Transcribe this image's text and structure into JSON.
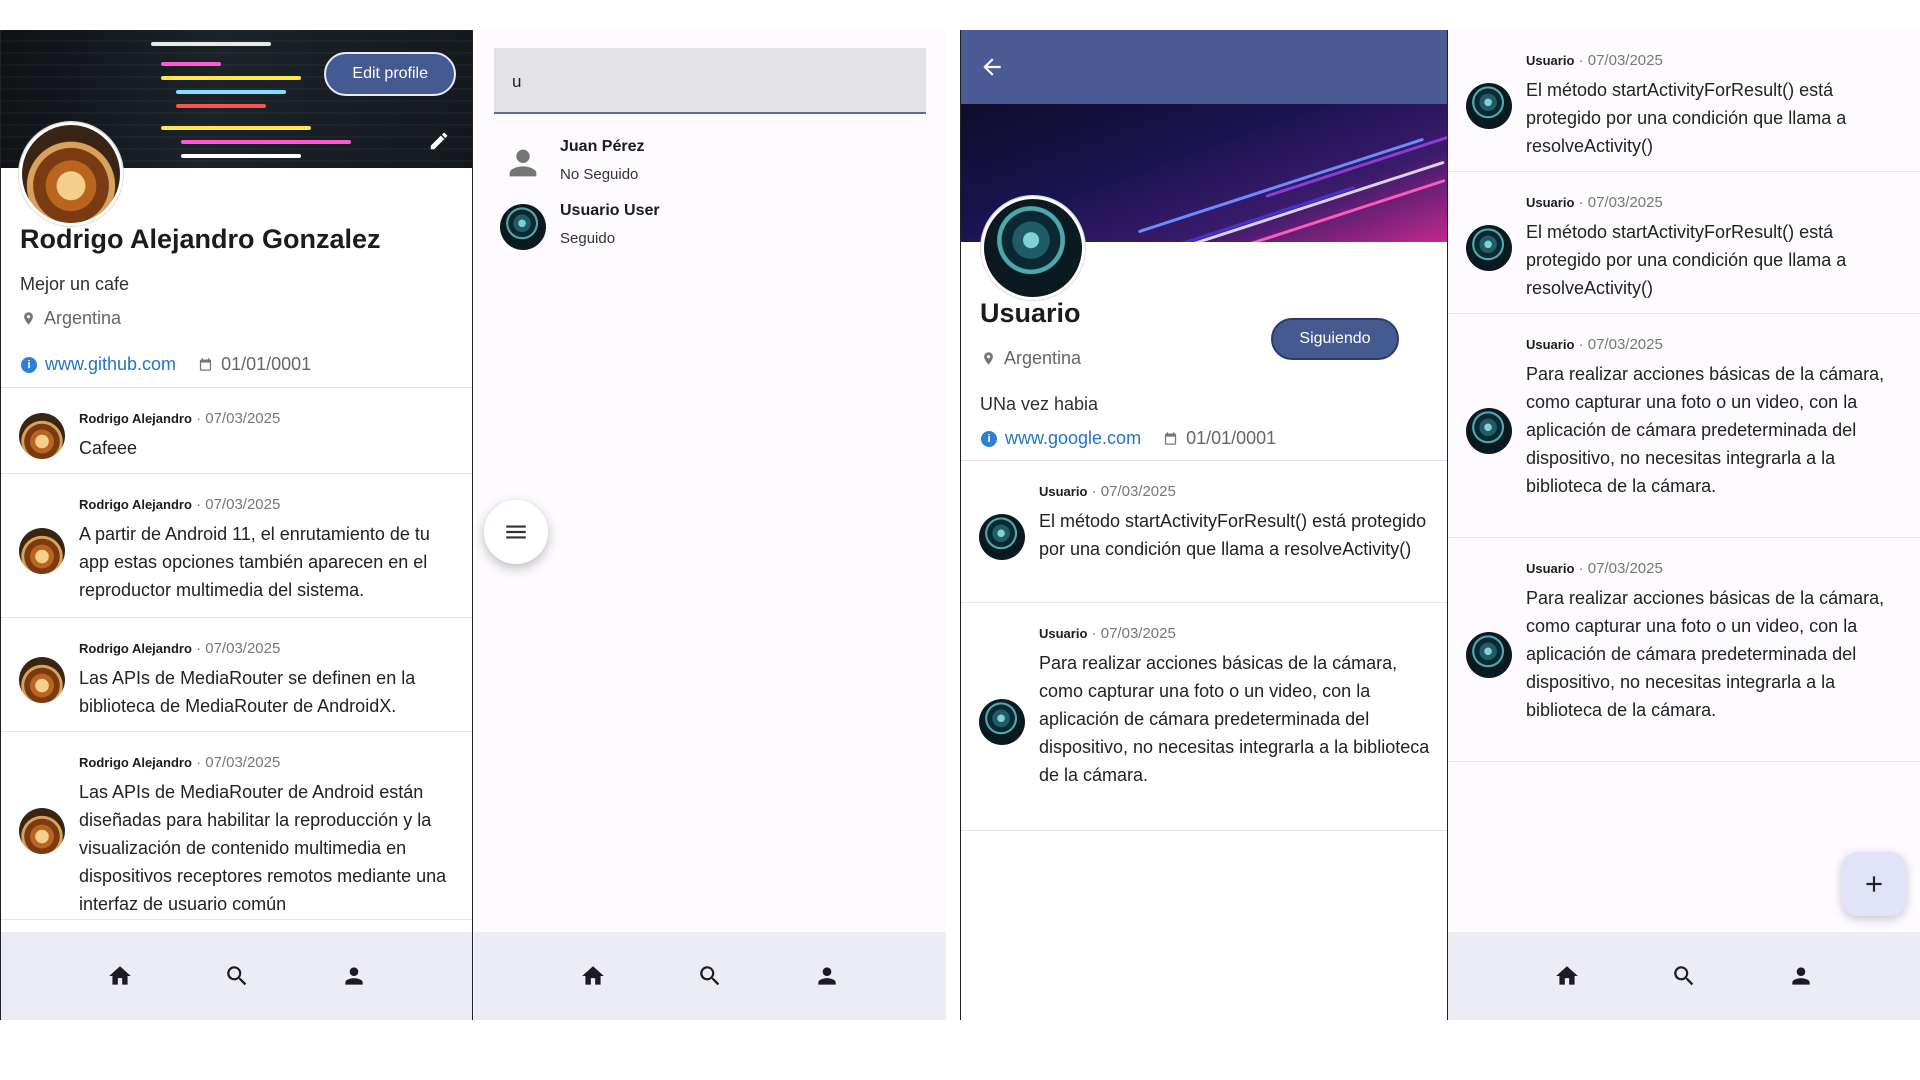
{
  "screen1": {
    "edit_profile_label": "Edit profile",
    "name": "Rodrigo Alejandro Gonzalez",
    "bio": "Mejor un cafe",
    "location": "Argentina",
    "website": "www.github.com",
    "date": "01/01/0001",
    "posts": [
      {
        "author": "Rodrigo Alejandro",
        "date": "07/03/2025",
        "text": "Cafeee"
      },
      {
        "author": "Rodrigo Alejandro",
        "date": "07/03/2025",
        "text": "A partir de Android 11, el enrutamiento de tu app estas opciones también aparecen en el reproductor multimedia del sistema."
      },
      {
        "author": "Rodrigo Alejandro",
        "date": "07/03/2025",
        "text": "Las APIs de MediaRouter se definen en la biblioteca de MediaRouter de AndroidX."
      },
      {
        "author": "Rodrigo Alejandro",
        "date": "07/03/2025",
        "text": "Las APIs de MediaRouter de Android están diseñadas para habilitar la reproducción y la visualización de contenido multimedia en dispositivos receptores remotos mediante una interfaz de usuario común"
      }
    ]
  },
  "screen2": {
    "search_value": "u",
    "results": [
      {
        "name": "Juan Pérez",
        "status": "No Seguido"
      },
      {
        "name": "Usuario User",
        "status": "Seguido"
      }
    ]
  },
  "screen3": {
    "name": "Usuario",
    "follow_label": "Siguiendo",
    "location": "Argentina",
    "bio": "UNa vez habia",
    "website": "www.google.com",
    "date": "01/01/0001",
    "posts": [
      {
        "author": "Usuario",
        "date": "07/03/2025",
        "text": "El método startActivityForResult() está protegido por una condición que llama a resolveActivity()"
      },
      {
        "author": "Usuario",
        "date": "07/03/2025",
        "text": "Para realizar acciones básicas de la cámara, como capturar una foto o un video, con la aplicación de cámara predeterminada del dispositivo, no necesitas integrarla a la biblioteca de la cámara."
      }
    ]
  },
  "screen4": {
    "posts": [
      {
        "author": "Usuario",
        "date": "07/03/2025",
        "text": "El método startActivityForResult() está protegido por una condición que llama a resolveActivity()"
      },
      {
        "author": "Usuario",
        "date": "07/03/2025",
        "text": "El método startActivityForResult() está protegido por una condición que llama a resolveActivity()"
      },
      {
        "author": "Usuario",
        "date": "07/03/2025",
        "text": "Para realizar acciones básicas de la cámara, como capturar una foto o un video, con la aplicación de cámara predeterminada del dispositivo, no necesitas integrarla a la biblioteca de la cámara."
      },
      {
        "author": "Usuario",
        "date": "07/03/2025",
        "text": "Para realizar acciones básicas de la cámara, como capturar una foto o un video, con la aplicación de cámara predeterminada del dispositivo, no necesitas integrarla a la biblioteca de la cámara."
      }
    ]
  },
  "icons": {
    "nav": [
      "home-icon",
      "search-icon",
      "person-icon"
    ],
    "location": "location-pin-icon",
    "calendar": "calendar-icon",
    "info": "info-icon",
    "edit": "pencil-icon",
    "menu": "menu-icon",
    "back": "arrow-back-icon",
    "add": "plus-icon"
  },
  "colors": {
    "primary": "#465a92",
    "link": "#2574c8",
    "nav_bg": "#ecedf4"
  }
}
